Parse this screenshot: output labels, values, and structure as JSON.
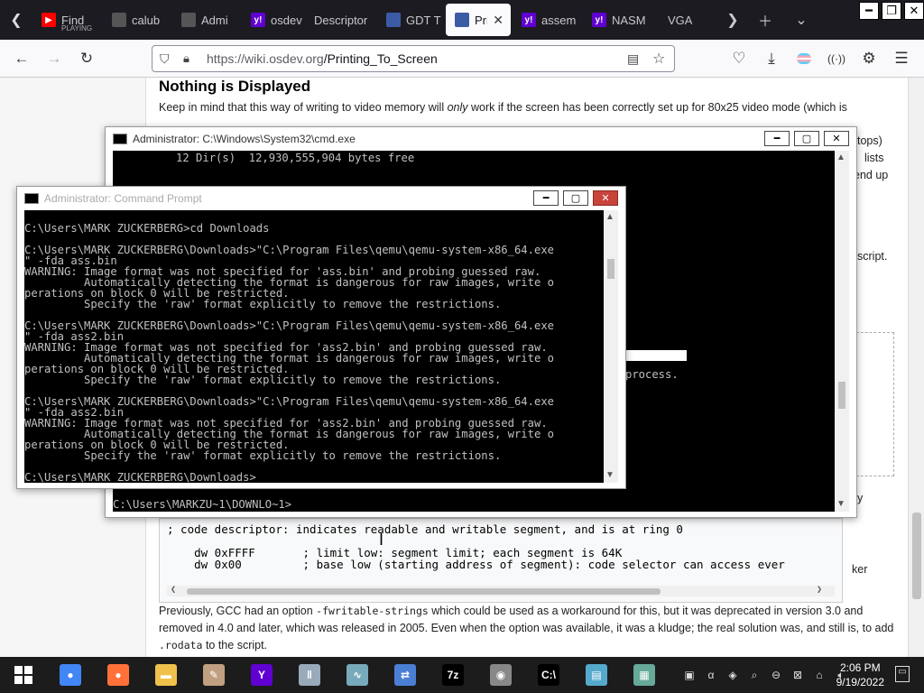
{
  "browser": {
    "tabs": [
      {
        "title": "Find",
        "subtitle": "PLAYING",
        "icon": "youtube-icon",
        "color": "#ff0000"
      },
      {
        "title": "calub",
        "icon": "page-icon",
        "color": "#555"
      },
      {
        "title": "Admi",
        "icon": "page-icon",
        "color": "#555"
      },
      {
        "title": "osdev",
        "icon": "yahoo-icon",
        "color": "#6001d2"
      },
      {
        "title": "Descriptor",
        "icon": "none",
        "color": "#1c1b22"
      },
      {
        "title": "GDT T",
        "icon": "page-icon",
        "color": "#3b5ba5"
      },
      {
        "title": "Prin",
        "icon": "osdev-icon",
        "color": "#3b5ba5",
        "active": true
      },
      {
        "title": "assem",
        "icon": "yahoo-icon",
        "color": "#6001d2"
      },
      {
        "title": "NASM",
        "icon": "yahoo-icon",
        "color": "#6001d2"
      },
      {
        "title": "VGA",
        "icon": "none",
        "color": "#1c1b22"
      }
    ],
    "url_host": "https://wiki.osdev.org",
    "url_path": "/Printing_To_Screen"
  },
  "page": {
    "heading": "Nothing is Displayed",
    "p1_pre": "Keep in mind that this way of writing to video memory will ",
    "p1_em": "only",
    "p1_post": " work if the screen has been correctly set up for 80x25 video mode (which is",
    "side_frags": [
      "tops)",
      "lists",
      "end up",
      "script.",
      "process.",
      "y",
      "ker"
    ],
    "code_lines": [
      "; code descriptor: indicates readable and writable segment, and is at ring 0",
      "",
      "    dw 0xFFFF       ; limit low: segment limit; each segment is 64K",
      "    dw 0x00         ; base low (starting address of segment): code selector can access ever"
    ],
    "p2_a": "Previously, GCC had an option ",
    "p2_code1": "-fwritable-strings",
    "p2_b": " which could be used as a workaround for this, but it was deprecated in version 3.0 and removed in 4.0 and later, which was released in 2005. Even when the option was available, it was a kludge; the real solution was, and still is, to add ",
    "p2_code2": ".rodata",
    "p2_c": " to the script."
  },
  "cmd_back": {
    "title": "Administrator: C:\\Windows\\System32\\cmd.exe",
    "lines": [
      "         12 Dir(s)  12,930,555,904 bytes free"
    ],
    "prompt": "C:\\Users\\MARKZU~1\\DOWNLO~1>"
  },
  "cmd_front": {
    "title": "Administrator: Command Prompt",
    "lines": [
      "",
      "C:\\Users\\MARK ZUCKERBERG>cd Downloads",
      "",
      "C:\\Users\\MARK ZUCKERBERG\\Downloads>\"C:\\Program Files\\qemu\\qemu-system-x86_64.exe",
      "\" -fda ass.bin",
      "WARNING: Image format was not specified for 'ass.bin' and probing guessed raw.",
      "         Automatically detecting the format is dangerous for raw images, write o",
      "perations on block 0 will be restricted.",
      "         Specify the 'raw' format explicitly to remove the restrictions.",
      "",
      "C:\\Users\\MARK ZUCKERBERG\\Downloads>\"C:\\Program Files\\qemu\\qemu-system-x86_64.exe",
      "\" -fda ass2.bin",
      "WARNING: Image format was not specified for 'ass2.bin' and probing guessed raw.",
      "         Automatically detecting the format is dangerous for raw images, write o",
      "perations on block 0 will be restricted.",
      "         Specify the 'raw' format explicitly to remove the restrictions.",
      "",
      "C:\\Users\\MARK ZUCKERBERG\\Downloads>\"C:\\Program Files\\qemu\\qemu-system-x86_64.exe",
      "\" -fda ass2.bin",
      "WARNING: Image format was not specified for 'ass2.bin' and probing guessed raw.",
      "         Automatically detecting the format is dangerous for raw images, write o",
      "perations on block 0 will be restricted.",
      "         Specify the 'raw' format explicitly to remove the restrictions.",
      "",
      "C:\\Users\\MARK ZUCKERBERG\\Downloads>"
    ]
  },
  "taskbar": {
    "apps": [
      {
        "name": "chrome-icon",
        "color": "#4285f4",
        "glyph": "●"
      },
      {
        "name": "firefox-icon",
        "color": "#ff7139",
        "glyph": "●"
      },
      {
        "name": "file-explorer-icon",
        "color": "#f0c24b",
        "glyph": "▬"
      },
      {
        "name": "paint-icon",
        "color": "#c0a080",
        "glyph": "✎"
      },
      {
        "name": "yahoo-messenger-icon",
        "color": "#6001d2",
        "glyph": "Y"
      },
      {
        "name": "audio-mixer-icon",
        "color": "#9ab",
        "glyph": "‖"
      },
      {
        "name": "resource-monitor-icon",
        "color": "#7ab",
        "glyph": "∿"
      },
      {
        "name": "network-icon",
        "color": "#4a7fd4",
        "glyph": "⇄"
      },
      {
        "name": "7zip-icon",
        "color": "#000",
        "glyph": "7z"
      },
      {
        "name": "media-disc-icon",
        "color": "#888",
        "glyph": "◉"
      },
      {
        "name": "cmd-icon",
        "color": "#000",
        "glyph": "C:\\"
      },
      {
        "name": "notepad-icon",
        "color": "#5ac",
        "glyph": "▤"
      },
      {
        "name": "calculator-icon",
        "color": "#6a9",
        "glyph": "▦"
      }
    ],
    "time": "2:06 PM",
    "date": "9/19/2022"
  }
}
